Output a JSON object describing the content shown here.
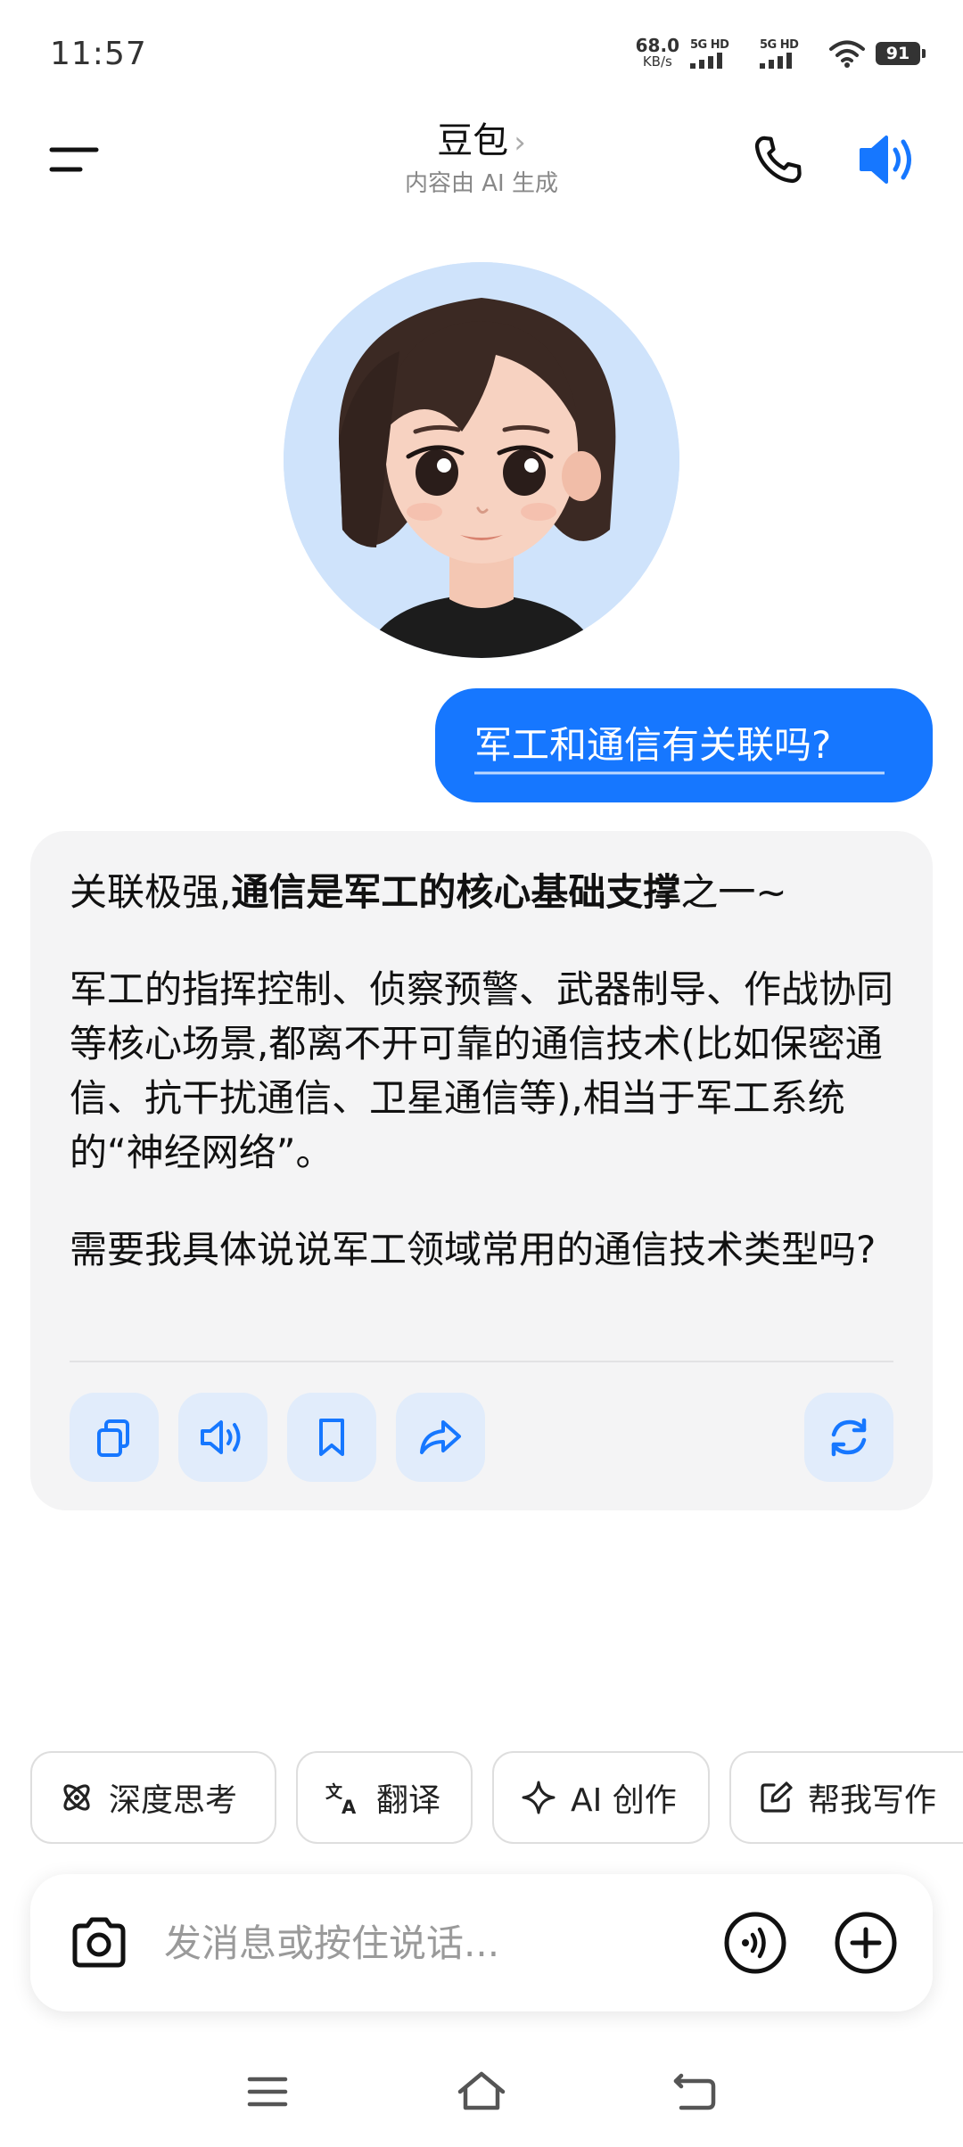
{
  "status_bar": {
    "time": "11:57",
    "net_speed_value": "68.0",
    "net_speed_unit": "KB/s",
    "signal1_label": "5G HD",
    "signal2_label": "5G HD",
    "battery": "91"
  },
  "header": {
    "title": "豆包",
    "subtitle": "内容由 AI 生成",
    "icons": {
      "menu": "menu-icon",
      "chevron": "chevron-right-icon",
      "call": "phone-icon",
      "speaker": "speaker-icon"
    }
  },
  "conversation": {
    "user_message": "军工和通信有关联吗?",
    "ai_reply": {
      "line1_prefix": "关联极强,",
      "line1_bold": "通信是军工的核心基础支撑",
      "line1_suffix": "之一~",
      "paragraph2": "军工的指挥控制、侦察预警、武器制导、作战协同等核心场景,都离不开可靠的通信技术(比如保密通信、抗干扰通信、卫星通信等),相当于军工系统的“神经网络”。",
      "paragraph3": "需要我具体说说军工领域常用的通信技术类型吗?"
    },
    "actions": [
      "copy-icon",
      "read-aloud-icon",
      "bookmark-icon",
      "share-icon",
      "regenerate-icon"
    ]
  },
  "quick_actions": [
    {
      "label": "深度思考",
      "icon": "deep-think-icon"
    },
    {
      "label": "翻译",
      "icon": "translate-icon"
    },
    {
      "label": "AI 创作",
      "icon": "sparkle-icon"
    },
    {
      "label": "帮我写作",
      "icon": "edit-icon"
    }
  ],
  "input": {
    "placeholder": "发消息或按住说话...",
    "value": ""
  },
  "colors": {
    "accent": "#1677ff",
    "bubble_ai": "#f4f4f5",
    "action_bg": "#e1ecfb"
  }
}
